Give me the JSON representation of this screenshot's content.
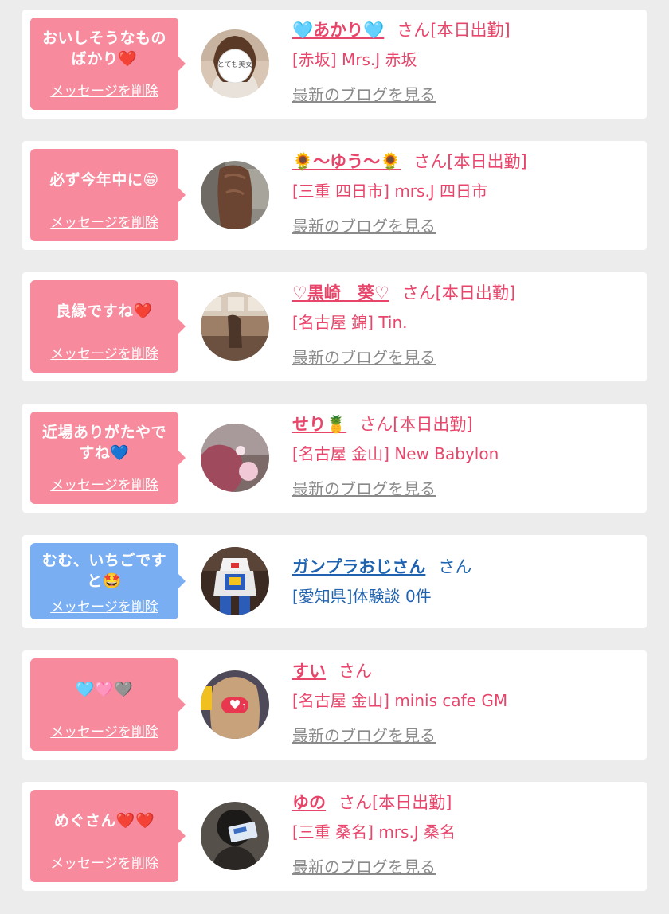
{
  "colors": {
    "pink_text": "#e8456b",
    "blue_text": "#1f63b0",
    "pink_bubble": "#f78a9c",
    "blue_bubble": "#7aaef3",
    "link_gray": "#8a8a8a"
  },
  "cards": [
    {
      "bubble_theme": "pink",
      "text_theme": "pink",
      "bubble_message": "おいしそうなものばかり❤️",
      "delete_label": "メッセージを削除",
      "name": "🩵あかり🩵",
      "name_suffix": "さん[本日出勤]",
      "shop": "[赤坂] Mrs.J 赤坂",
      "blog_link": "最新のブログを見る",
      "avatar_caption": "とても美女",
      "avatar": "avatar-woman-sticker"
    },
    {
      "bubble_theme": "pink",
      "text_theme": "pink",
      "bubble_message": "必ず今年中に😁",
      "delete_label": "メッセージを削除",
      "name": "🌻〜ゆう〜🌻",
      "name_suffix": "さん[本日出勤]",
      "shop": "[三重 四日市] mrs.J 四日市",
      "blog_link": "最新のブログを見る",
      "avatar": "avatar-hair-back"
    },
    {
      "bubble_theme": "pink",
      "text_theme": "pink",
      "bubble_message": "良縁ですね❤️",
      "delete_label": "メッセージを削除",
      "name": "♡黒崎　葵♡",
      "name_suffix": "さん[本日出勤]",
      "shop": "[名古屋 錦] Tin.",
      "blog_link": "最新のブログを見る",
      "avatar": "avatar-room-photo"
    },
    {
      "bubble_theme": "pink",
      "text_theme": "pink",
      "bubble_message": "近場ありがたやですね💙",
      "delete_label": "メッセージを削除",
      "name": "せり🍍",
      "name_suffix": "さん[本日出勤]",
      "shop": "[名古屋 金山] New Babylon",
      "blog_link": "最新のブログを見る",
      "avatar": "avatar-blurred-hair"
    },
    {
      "bubble_theme": "blue",
      "text_theme": "blue",
      "bubble_message": "むむ、いちごですと🤩",
      "delete_label": "メッセージを削除",
      "name": "ガンプラおじさん",
      "name_suffix": "さん",
      "shop": "[愛知県]体験談 0件",
      "blog_link": "",
      "avatar": "avatar-gundam-model"
    },
    {
      "bubble_theme": "pink",
      "text_theme": "pink",
      "bubble_message": "🩵🩷🩶",
      "delete_label": "メッセージを削除",
      "name": "すい",
      "name_suffix": "さん",
      "shop": "[名古屋 金山] minis cafe GM",
      "blog_link": "最新のブログを見る",
      "avatar_badge": "1",
      "avatar": "avatar-like-badge"
    },
    {
      "bubble_theme": "pink",
      "text_theme": "pink",
      "bubble_message": "めぐさん❤️❤️",
      "delete_label": "メッセージを削除",
      "name": "ゆの",
      "name_suffix": "さん[本日出勤]",
      "shop": "[三重 桑名] mrs.J 桑名",
      "blog_link": "最新のブログを見る",
      "avatar": "avatar-card-hold"
    }
  ]
}
